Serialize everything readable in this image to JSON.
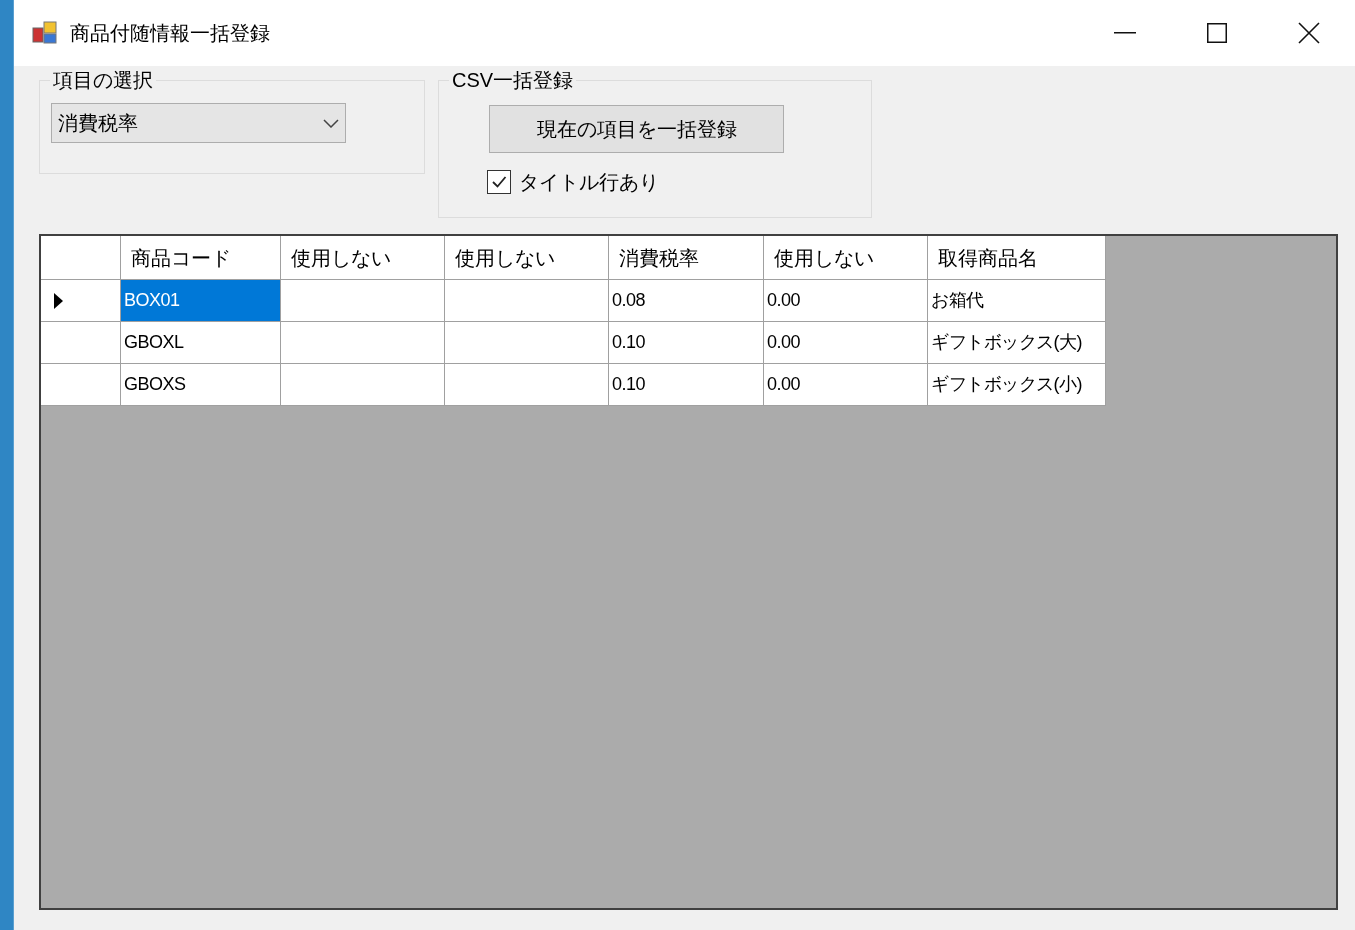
{
  "window": {
    "title": "商品付随情報一括登録"
  },
  "item_group": {
    "title": "項目の選択",
    "dropdown": {
      "value": "消費税率"
    }
  },
  "csv_group": {
    "title": "CSV一括登録",
    "button": "現在の項目を一括登録",
    "checkbox": {
      "label": "タイトル行あり",
      "checked": true
    }
  },
  "table": {
    "columns": [
      "商品コード",
      "使用しない",
      "使用しない",
      "消費税率",
      "使用しない",
      "取得商品名"
    ],
    "rows": [
      {
        "selected": true,
        "cells": [
          "BOX01",
          null,
          null,
          "0.08",
          "0.00",
          "お箱代"
        ]
      },
      {
        "selected": false,
        "cells": [
          "GBOXL",
          null,
          null,
          "0.10",
          "0.00",
          "ギフトボックス(大)"
        ]
      },
      {
        "selected": false,
        "cells": [
          "GBOXS",
          null,
          null,
          "0.10",
          "0.00",
          "ギフトボックス(小)"
        ]
      }
    ]
  }
}
